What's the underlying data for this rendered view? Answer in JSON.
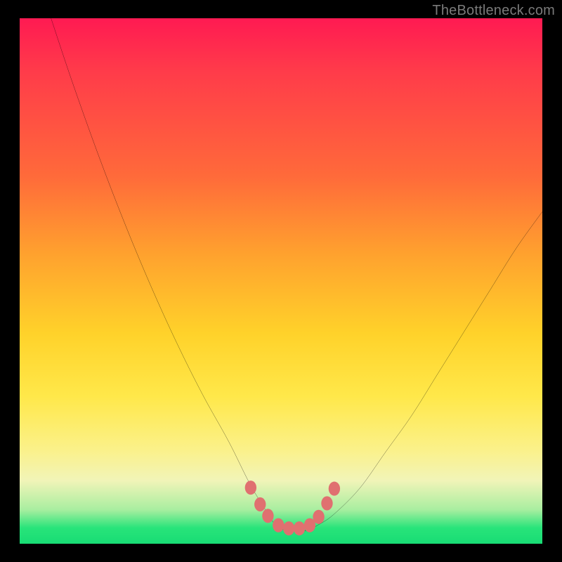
{
  "watermark": "TheBottleneck.com",
  "chart_data": {
    "type": "line",
    "title": "",
    "xlabel": "",
    "ylabel": "",
    "xlim": [
      0,
      100
    ],
    "ylim": [
      0,
      100
    ],
    "series": [
      {
        "name": "bottleneck-curve",
        "x": [
          6,
          10,
          15,
          20,
          25,
          30,
          35,
          40,
          44,
          47,
          49,
          51,
          53,
          55,
          57,
          60,
          65,
          70,
          75,
          80,
          85,
          90,
          95,
          100
        ],
        "y": [
          100,
          88,
          74,
          61,
          49,
          38,
          28,
          19,
          11,
          6,
          3,
          2,
          2,
          2,
          3,
          5,
          10,
          17,
          24,
          32,
          40,
          48,
          56,
          63
        ]
      }
    ],
    "markers": {
      "name": "highlight-dots",
      "color": "#e07070",
      "x": [
        44.2,
        46.0,
        47.5,
        49.5,
        51.5,
        53.5,
        55.5,
        57.2,
        58.8,
        60.2
      ],
      "y": [
        10.2,
        7.0,
        4.8,
        3.0,
        2.4,
        2.4,
        3.0,
        4.6,
        7.2,
        10.0
      ]
    },
    "gradient_stops": [
      {
        "pos": 0.0,
        "color": "#ff1a52"
      },
      {
        "pos": 0.3,
        "color": "#ff6a3a"
      },
      {
        "pos": 0.6,
        "color": "#ffd22a"
      },
      {
        "pos": 0.88,
        "color": "#f1f4b8"
      },
      {
        "pos": 1.0,
        "color": "#18dc74"
      }
    ]
  }
}
